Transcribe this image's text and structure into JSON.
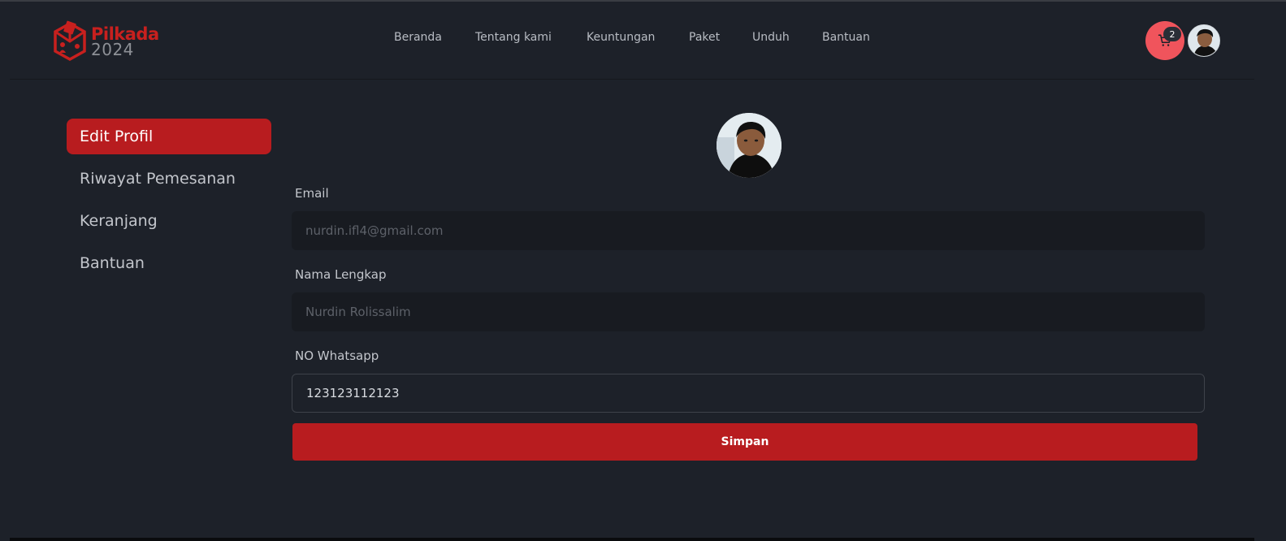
{
  "brand": {
    "name": "Pilkada",
    "year": "2024",
    "color": "#c8201e"
  },
  "nav": {
    "items": [
      {
        "label": "Beranda"
      },
      {
        "label": "Tentang kami"
      },
      {
        "label": "Keuntungan"
      },
      {
        "label": "Paket"
      },
      {
        "label": "Unduh"
      },
      {
        "label": "Bantuan"
      }
    ],
    "cart_count": "2",
    "cart_icon": "cart-icon",
    "avatar_icon": "user-avatar"
  },
  "sidebar": {
    "items": [
      {
        "label": "Edit Profil",
        "active": true
      },
      {
        "label": "Riwayat Pemesanan",
        "active": false
      },
      {
        "label": "Keranjang",
        "active": false
      },
      {
        "label": "Bantuan",
        "active": false
      }
    ]
  },
  "form": {
    "email": {
      "label": "Email",
      "value": "nurdin.ifl4@gmail.com"
    },
    "full_name": {
      "label": "Nama Lengkap",
      "value": "Nurdin Rolissalim"
    },
    "whatsapp": {
      "label": "NO Whatsapp",
      "value": "123123112123"
    },
    "save_label": "Simpan"
  },
  "colors": {
    "accent": "#b81c1f",
    "background": "#1d2129",
    "cart": "#f0545c"
  }
}
